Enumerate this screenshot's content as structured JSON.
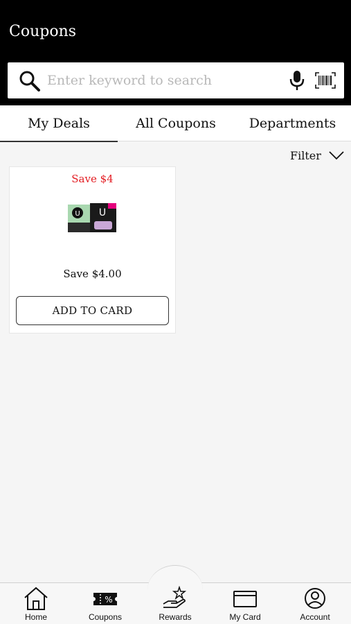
{
  "header": {
    "title": "Coupons"
  },
  "search": {
    "placeholder": "Enter keyword to search"
  },
  "tabs": [
    {
      "label": "My Deals",
      "active": true
    },
    {
      "label": "All Coupons",
      "active": false
    },
    {
      "label": "Departments",
      "active": false
    }
  ],
  "filter": {
    "label": "Filter"
  },
  "coupons": [
    {
      "save_label": "Save $4",
      "save_amount": "Save $4.00",
      "button_label": "ADD TO CARD"
    }
  ],
  "bottom_nav": [
    {
      "label": "Home",
      "icon": "home-icon"
    },
    {
      "label": "Coupons",
      "icon": "coupon-ticket-icon"
    },
    {
      "label": "Rewards",
      "icon": "rewards-hand-star-icon"
    },
    {
      "label": "My Card",
      "icon": "card-icon"
    },
    {
      "label": "Account",
      "icon": "account-icon"
    }
  ],
  "colors": {
    "header_bg": "#000000",
    "save_red": "#e31e24",
    "page_bg": "#f5f5f5"
  }
}
